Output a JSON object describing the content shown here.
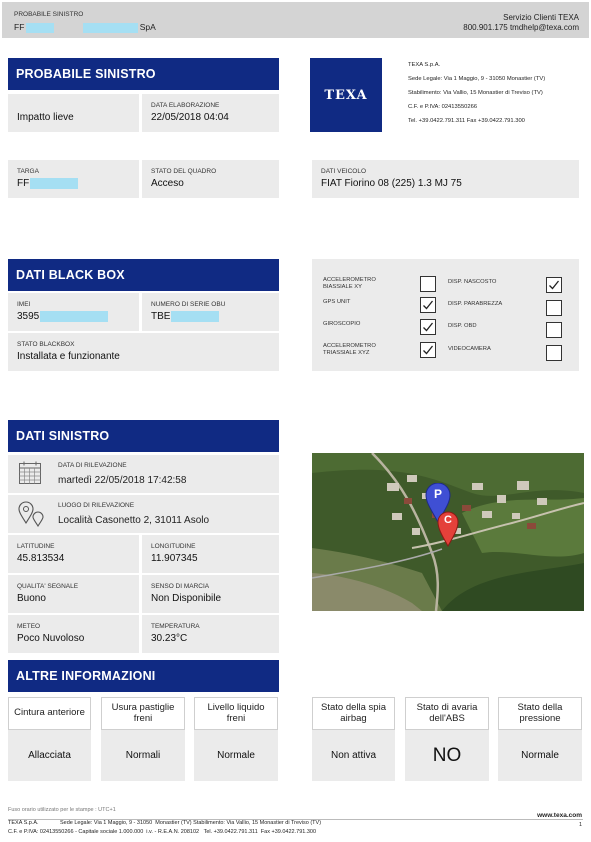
{
  "header": {
    "label": "PROBABILE SINISTRO",
    "client_prefix": "FF",
    "client_suffix": "SpA",
    "service": "Servizio Clienti TEXA",
    "contact": "800.901.175  tmdhelp@texa.com"
  },
  "section_probabile": {
    "title": "PROBABILE SINISTRO",
    "impact": "Impatto lieve",
    "elaboration_label": "DATA ELABORAZIONE",
    "elaboration_value": "22/05/2018 04:04"
  },
  "company": {
    "logo": "TEXA",
    "name": "TEXA S.p.A.",
    "legal": "Sede Legale: Via 1 Maggio, 9 - 31050  Monastier (TV)",
    "plant": "Stabilimento: Via Vallio, 15 Monastier di Treviso (TV)",
    "vat": "C.F. e P.IVA: 02413550266",
    "phone": "Tel. +39.0422.791.311  Fax +39.0422.791.300"
  },
  "vehicle": {
    "plate_label": "TARGA",
    "plate_prefix": "FF",
    "state_label": "STATO DEL QUADRO",
    "state_value": "Acceso",
    "data_label": "DATI VEICOLO",
    "data_value": "FIAT Fiorino 08 (225) 1.3 MJ 75"
  },
  "blackbox": {
    "title": "DATI BLACK BOX",
    "imei_label": "IMEI",
    "imei_prefix": "3595",
    "serial_label": "NUMERO DI SERIE OBU",
    "serial_prefix": "TBE",
    "status_label": "STATO BLACKBOX",
    "status_value": "Installata e funzionante",
    "features": [
      {
        "label": "ACCELEROMETRO BIASSIALE XY",
        "checked": false
      },
      {
        "label": "GPS UNIT",
        "checked": true
      },
      {
        "label": "GIROSCOPIO",
        "checked": true
      },
      {
        "label": "ACCELEROMETRO TRIASSIALE XYZ",
        "checked": true
      },
      {
        "label": "DISP. NASCOSTO",
        "checked": true
      },
      {
        "label": "DISP. PARABREZZA",
        "checked": false
      },
      {
        "label": "DISP. OBD",
        "checked": false
      },
      {
        "label": "VIDEOCAMERA",
        "checked": false
      }
    ]
  },
  "sinistro": {
    "title": "DATI SINISTRO",
    "date_label": "DATA DI RILEVAZIONE",
    "date_value": "martedì 22/05/2018 17:42:58",
    "place_label": "LUOGO DI RILEVAZIONE",
    "place_value": "Località Casonetto 2, 31011 Asolo",
    "lat_label": "LATITUDINE",
    "lat_value": "45.813534",
    "lon_label": "LONGITUDINE",
    "lon_value": "11.907345",
    "signal_label": "QUALITA' SEGNALE",
    "signal_value": "Buono",
    "direction_label": "SENSO DI MARCIA",
    "direction_value": "Non Disponibile",
    "meteo_label": "METEO",
    "meteo_value": "Poco Nuvoloso",
    "temp_label": "TEMPERATURA",
    "temp_value": "30.23°C",
    "map_pin_p": "P",
    "map_pin_c": "C"
  },
  "altre": {
    "title": "ALTRE INFORMAZIONI",
    "items": [
      {
        "title": "Cintura anteriore",
        "value": "Allacciata"
      },
      {
        "title": "Usura pastiglie freni",
        "value": "Normali"
      },
      {
        "title": "Livello liquido freni",
        "value": "Normale"
      },
      {
        "title": "Stato della spia airbag",
        "value": "Non attiva"
      },
      {
        "title": "Stato di avaria dell'ABS",
        "value": "NO"
      },
      {
        "title": "Stato della pressione",
        "value": "Normale"
      }
    ]
  },
  "footer": {
    "timezone": "Fuso orario utilizzato per le stampe : UTC+1",
    "line1": "TEXA S.p.A.              Sede Legale: Via 1 Maggio, 9 - 31050  Monastier (TV) Stabilimento: Via Vallio, 15 Monastier di Treviso (TV)",
    "line2": "C.F. e P.IVA: 02413550266 - Capitale sociale 1.000.000  i.v. - R.E.A.N. 208102   Tel. +39.0422.791.311  Fax +39.0422.791.300",
    "website": "www.texa.com",
    "page": "1"
  },
  "colors": {
    "header_blue": "#102a83",
    "mask": "#a5dff3",
    "box": "#ebebeb"
  }
}
